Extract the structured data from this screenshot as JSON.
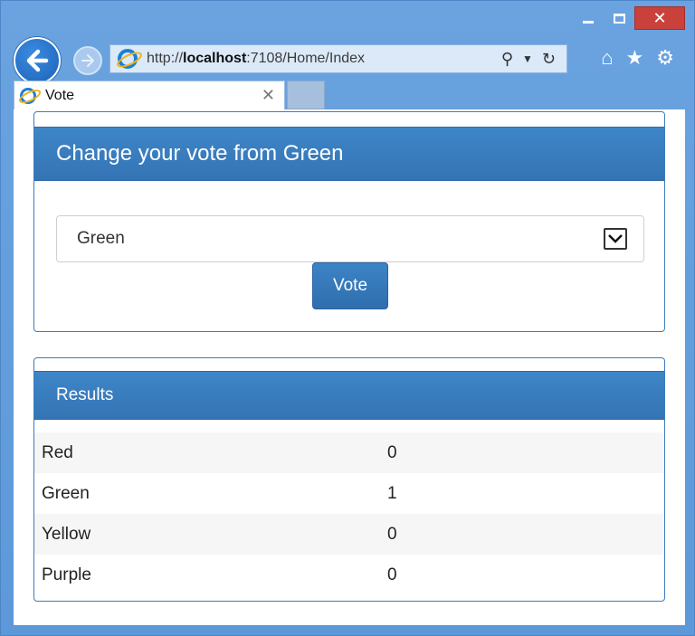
{
  "browser": {
    "url_prefix": "http://",
    "url_host": "localhost",
    "url_rest": ":7108/Home/Index",
    "tab_title": "Vote",
    "icons": {
      "back": "back-arrow-icon",
      "forward": "forward-arrow-icon",
      "search": "search-icon",
      "refresh": "refresh-icon",
      "home": "home-icon",
      "favorites": "star-icon",
      "settings": "gear-icon",
      "close": "close-icon"
    }
  },
  "vote_panel": {
    "title": "Change your vote from Green",
    "selected_option": "Green",
    "vote_label": "Vote"
  },
  "results_panel": {
    "title": "Results",
    "rows": [
      {
        "name": "Red",
        "count": "0"
      },
      {
        "name": "Green",
        "count": "1"
      },
      {
        "name": "Yellow",
        "count": "0"
      },
      {
        "name": "Purple",
        "count": "0"
      }
    ]
  },
  "colors": {
    "chrome_blue": "#6aa3df",
    "panel_heading": "#3474b4",
    "close_red": "#c9413a"
  }
}
